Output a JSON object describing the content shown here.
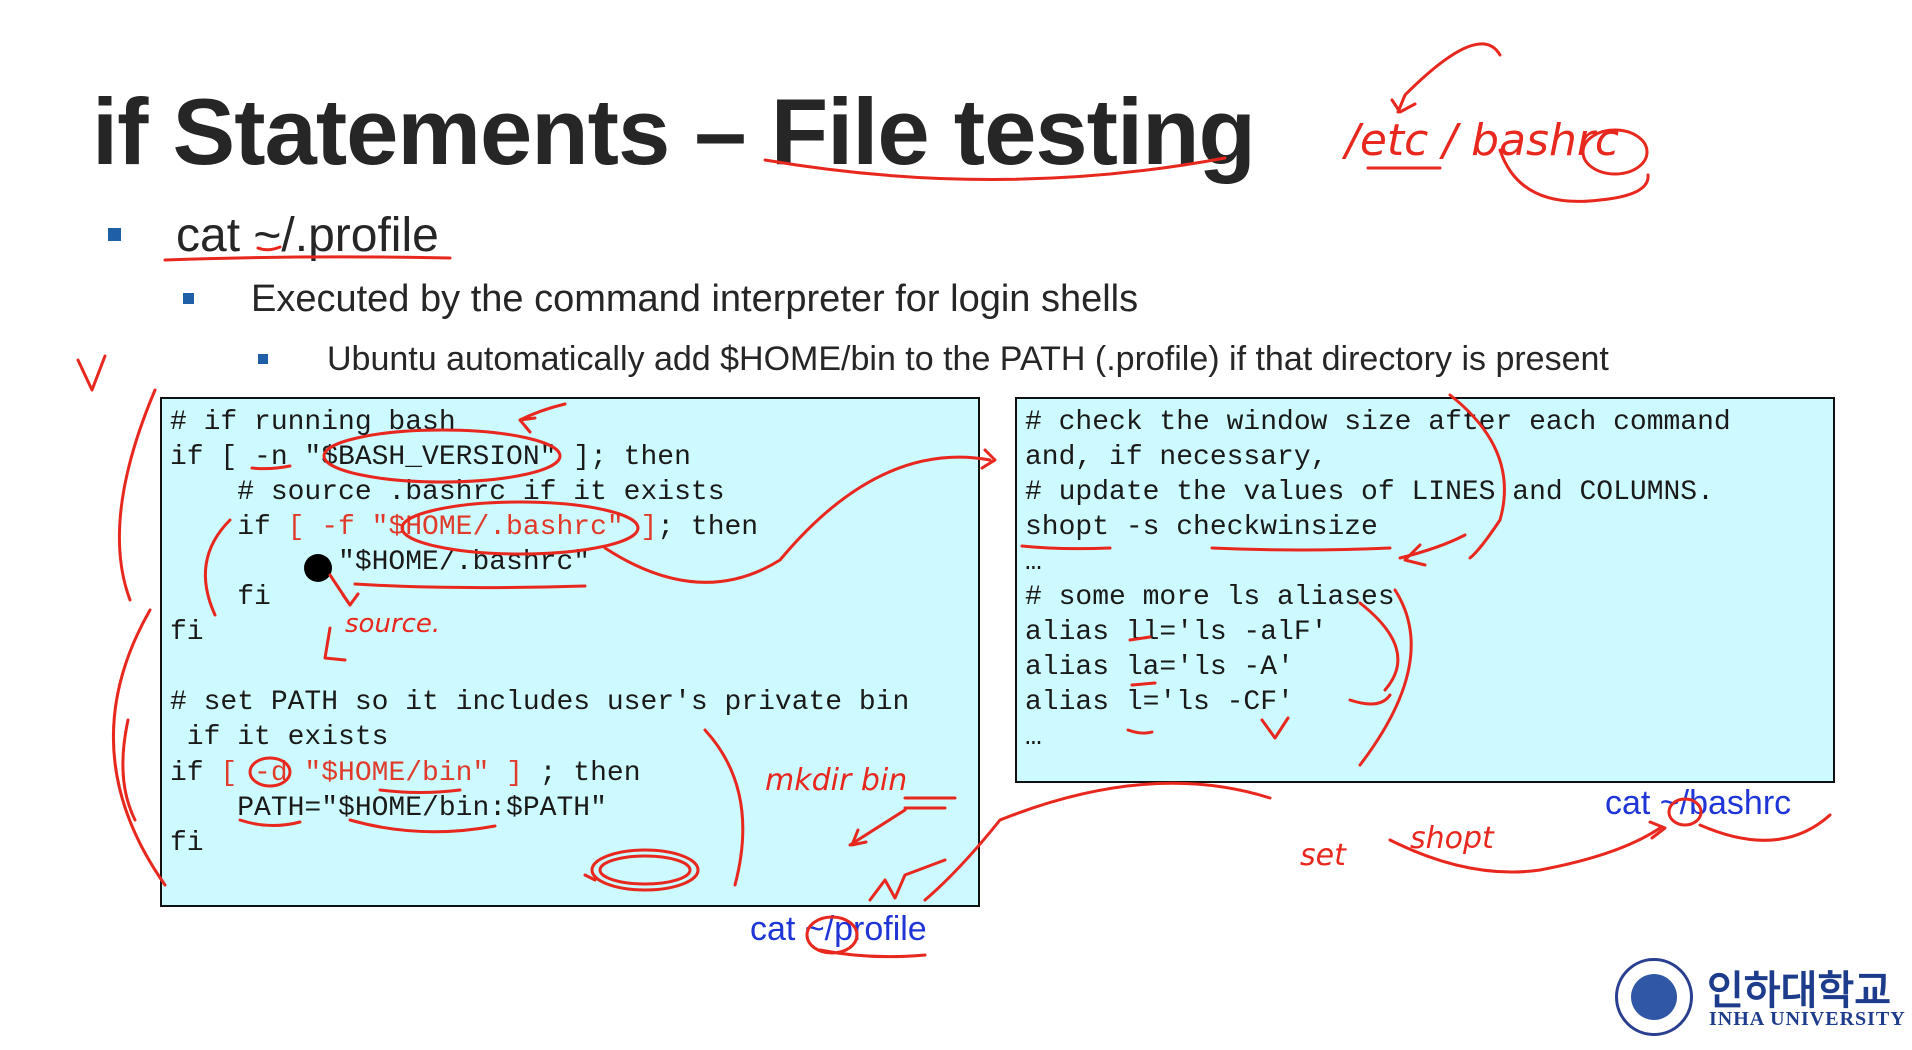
{
  "slide": {
    "title": "if Statements – File testing",
    "bullets": {
      "level1": "cat ~/.profile",
      "level2": "Executed by the command interpreter for login shells",
      "level3": "Ubuntu  automatically add $HOME/bin to the PATH (.profile)  if that directory is present"
    },
    "left_code": {
      "lines": [
        "# if running bash",
        "if [ -n \"$BASH_VERSION\" ]; then",
        "    # source .bashrc if it exists",
        "    if ",
        "[ -f \"$HOME/.bashrc\" ]",
        "; then",
        "        . \"$HOME/.bashrc\"",
        "    fi",
        "fi",
        "# set PATH so it includes user's private bin",
        " if it exists",
        "if ",
        "[ -d \"$HOME/bin\" ]",
        " ; then",
        "    PATH=\"$HOME/bin:$PATH\"",
        "fi"
      ]
    },
    "right_code": {
      "lines": [
        "# check the window size after each command",
        "and, if necessary,",
        "# update the values of LINES and COLUMNS.",
        "shopt -s checkwinsize",
        "…",
        "# some more ls aliases",
        "alias ll='ls -alF'",
        "alias la='ls -A'",
        "alias l='ls -CF'",
        "…"
      ]
    },
    "captions": {
      "left": "cat ~/profile",
      "right": "cat ~/bashrc"
    },
    "logo": {
      "korean": "인하대학교",
      "english": "INHA UNIVERSITY"
    },
    "colors": {
      "title": "#262626",
      "bullet": "#1f5fa8",
      "code_bg": "#ccfaff",
      "code_red": "#e03a2b",
      "caption": "#1f35d6",
      "ink": "#e8281e"
    }
  }
}
